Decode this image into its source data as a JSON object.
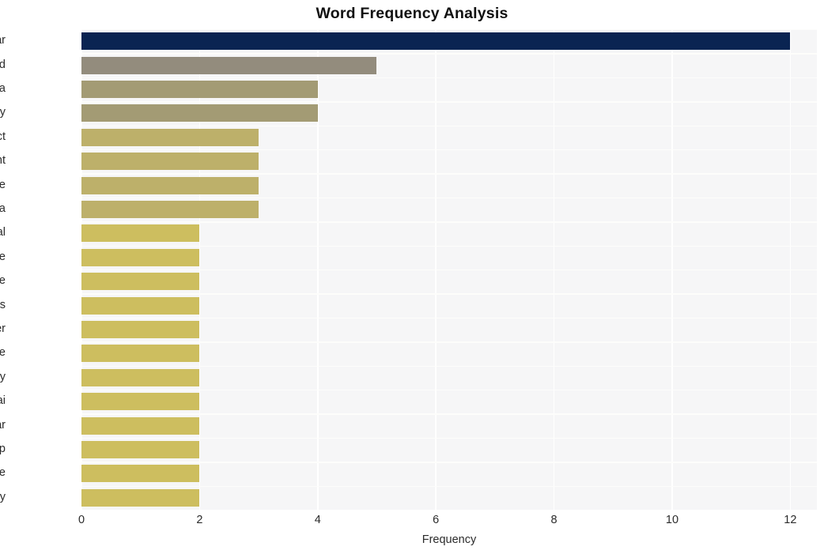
{
  "chart_data": {
    "type": "bar",
    "orientation": "horizontal",
    "title": "Word Frequency Analysis",
    "xlabel": "Frequency",
    "ylabel": "",
    "categories": [
      "myanmar",
      "thailand",
      "junta",
      "military",
      "conflict",
      "government",
      "include",
      "srettha",
      "neutral",
      "people",
      "force",
      "reuters",
      "minister",
      "parnpree",
      "tuesday",
      "thai",
      "war",
      "group",
      "peace",
      "insurgency"
    ],
    "values": [
      12,
      5,
      4,
      4,
      3,
      3,
      3,
      3,
      2,
      2,
      2,
      2,
      2,
      2,
      2,
      2,
      2,
      2,
      2,
      2
    ],
    "bar_colors": [
      "#0a2452",
      "#938c7d",
      "#a39b74",
      "#a39b74",
      "#bdb06a",
      "#bdb06a",
      "#bdb06a",
      "#bdb06a",
      "#cdbe5f",
      "#cdbe5f",
      "#cdbe5f",
      "#cdbe5f",
      "#cdbe5f",
      "#cdbe5f",
      "#cdbe5f",
      "#cdbe5f",
      "#cdbe5f",
      "#cdbe5f",
      "#cdbe5f",
      "#cdbe5f"
    ],
    "xlim": [
      0,
      12.45
    ],
    "xticks": [
      0,
      2,
      4,
      6,
      8,
      10,
      12
    ],
    "xticklabels": [
      "0",
      "2",
      "4",
      "6",
      "8",
      "10",
      "12"
    ],
    "grid": true,
    "grid_color": "#ffffff",
    "plot_background": "#f6f6f7",
    "figure_background": "#ffffff",
    "legend": null
  }
}
